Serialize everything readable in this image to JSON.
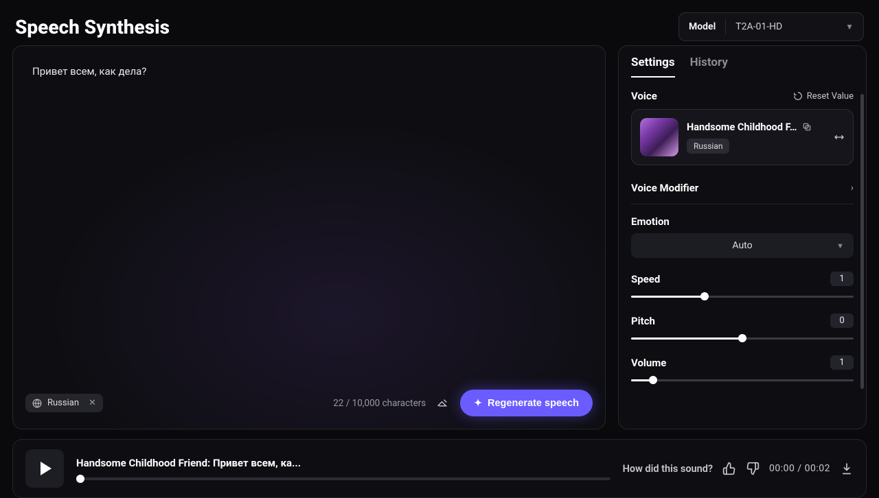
{
  "header": {
    "title": "Speech Synthesis",
    "model_label": "Model",
    "model_value": "T2A-01-HD"
  },
  "editor": {
    "text": "Привет всем, как дела?",
    "language_chip": "Russian",
    "char_count": "22 / 10,000 characters",
    "regenerate_label": "Regenerate speech"
  },
  "settings": {
    "tabs": {
      "settings": "Settings",
      "history": "History"
    },
    "voice_section": "Voice",
    "reset_label": "Reset Value",
    "voice": {
      "name": "Handsome Childhood F…",
      "language": "Russian"
    },
    "voice_modifier": "Voice Modifier",
    "emotion_label": "Emotion",
    "emotion_value": "Auto",
    "speed": {
      "label": "Speed",
      "value": "1",
      "percent": 33
    },
    "pitch": {
      "label": "Pitch",
      "value": "0",
      "percent": 50
    },
    "volume": {
      "label": "Volume",
      "value": "1",
      "percent": 10
    }
  },
  "player": {
    "title": "Handsome Childhood Friend: Привет всем, ка...",
    "feedback_q": "How did this sound?",
    "time": "00:00 / 00:02"
  }
}
